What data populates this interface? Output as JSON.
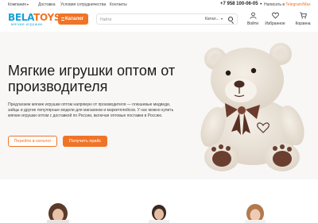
{
  "topbar": {
    "links": [
      "Компания",
      "Доставка",
      "Условия сотрудничества",
      "Контакты"
    ],
    "phone": "+7 958 100-06-05",
    "tg_prefix": "Написать в",
    "tg_link": "Telegram/Max"
  },
  "header": {
    "logo_main": "BELA",
    "logo_accent": "TOYS",
    "logo_sub": "мягкие игрушки",
    "catalog_label": "Каталог",
    "search_placeholder": "Найти",
    "search_scope": "Катал...",
    "icons": [
      {
        "name": "user-icon",
        "label": "Войти"
      },
      {
        "name": "heart-icon",
        "label": "Избранное"
      },
      {
        "name": "cart-icon",
        "label": "Корзина"
      }
    ]
  },
  "hero": {
    "title": "Мягкие игрушки оптом от производителя",
    "text": "Предлагаем мягкие игрушки оптом напрямую от производителя — плюшевые медведи, зайцы и другие популярные модели для магазинов и маркетплейсов. У нас можно купить мягкие игрушки оптом с доставкой по России, включая оптовые поставки в Россию.",
    "btn_catalog": "Перейти в каталог",
    "btn_price": "Получить прайс"
  },
  "colors": {
    "accent": "#f07427",
    "logo_blue": "#1aa0d8",
    "hero_bg": "#f8f7f6"
  }
}
